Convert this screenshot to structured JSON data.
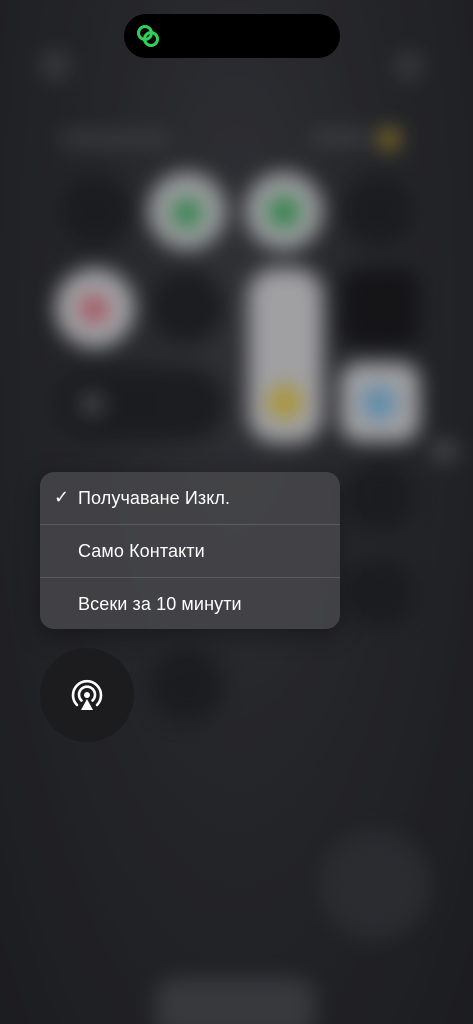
{
  "status": {
    "activity_icon": "link-icon",
    "activity_color": "#30d158"
  },
  "airdrop_menu": {
    "items": [
      {
        "label": "Получаване Изкл.",
        "checked": true
      },
      {
        "label": "Само Контакти",
        "checked": false
      },
      {
        "label": "Всеки за 10 минути",
        "checked": false
      }
    ],
    "check_symbol": "✓"
  },
  "airdrop_button": {
    "icon": "airdrop-icon"
  }
}
